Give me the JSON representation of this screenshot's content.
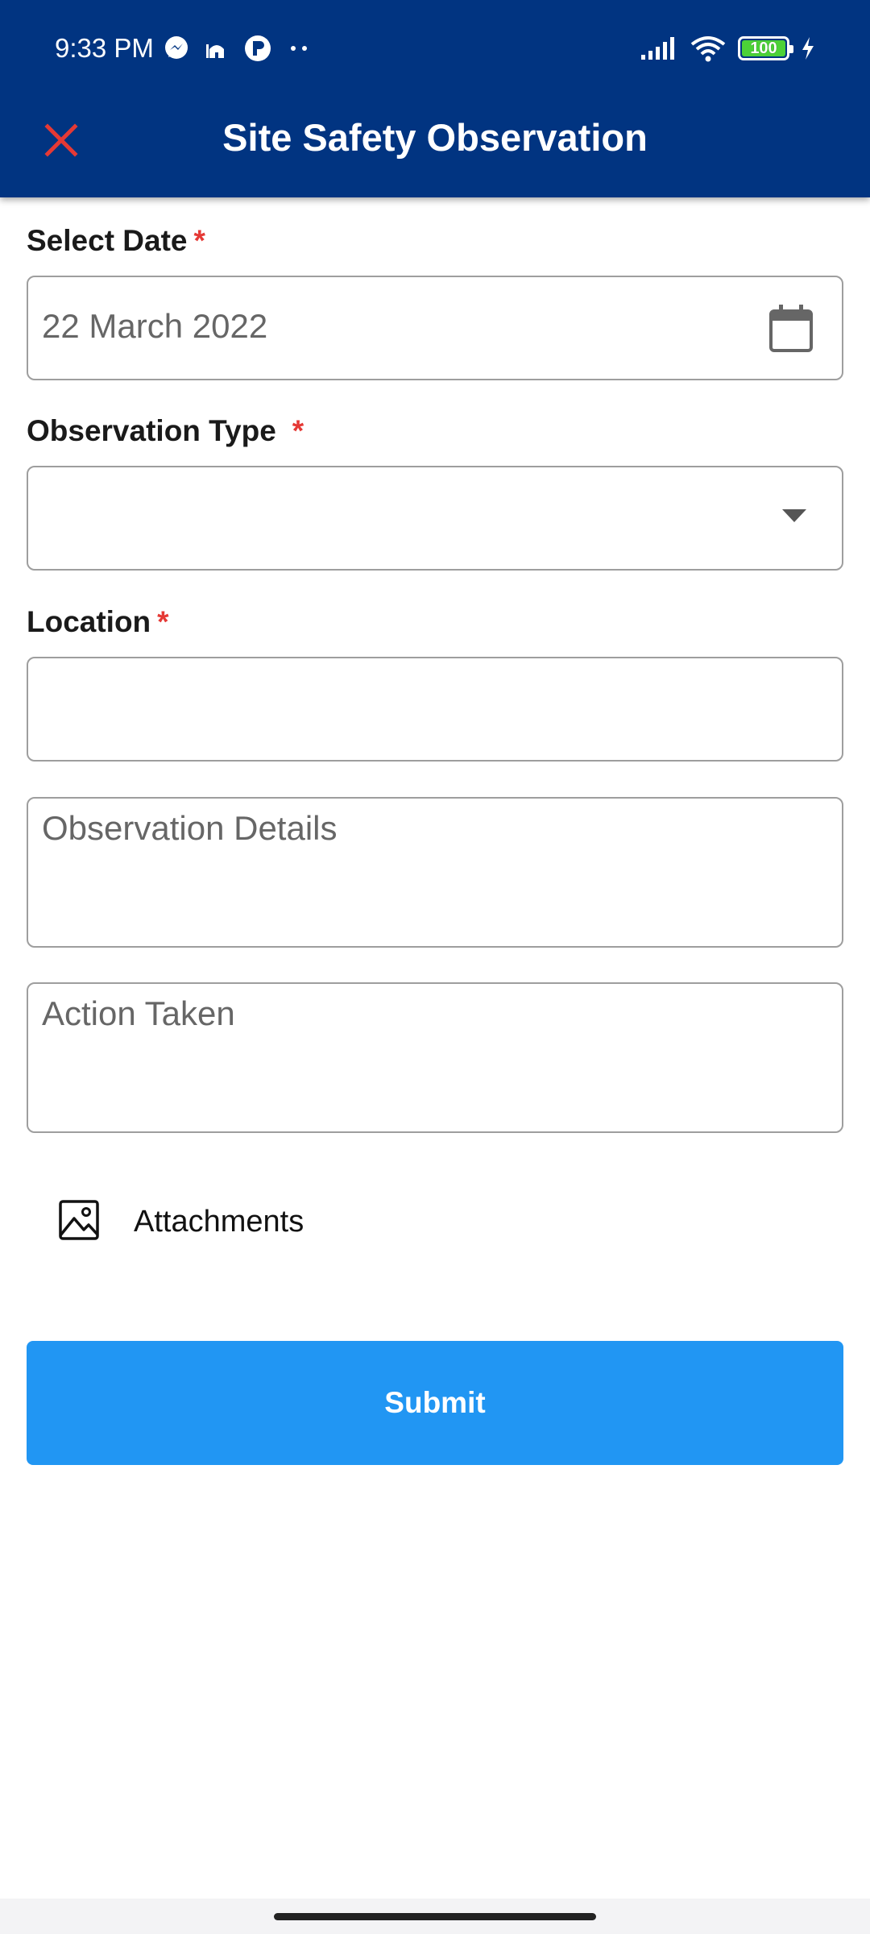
{
  "status_bar": {
    "time": "9:33 PM",
    "battery_level": "100",
    "left_icons": [
      "messenger-icon",
      "mosque-icon",
      "p-app-icon",
      "more-dots-icon"
    ],
    "right_icons": [
      "signal-icon",
      "wifi-icon",
      "battery-icon",
      "charging-icon"
    ]
  },
  "app_bar": {
    "title": "Site Safety Observation",
    "close_icon": "close-icon",
    "accent_color": "#e53935",
    "background_color": "#013481"
  },
  "form": {
    "date": {
      "label": "Select Date",
      "required_mark": "*",
      "value": "22 March 2022",
      "icon": "calendar-icon"
    },
    "observation_type": {
      "label": "Observation Type",
      "required_mark": "*",
      "value": "",
      "icon": "dropdown-caret-icon"
    },
    "location": {
      "label": "Location",
      "required_mark": "*",
      "value": ""
    },
    "observation_details": {
      "placeholder": "Observation Details",
      "value": ""
    },
    "action_taken": {
      "placeholder": "Action Taken",
      "value": ""
    },
    "attachments": {
      "label": "Attachments",
      "icon": "image-icon"
    },
    "submit": {
      "label": "Submit",
      "color": "#2196f3"
    }
  }
}
